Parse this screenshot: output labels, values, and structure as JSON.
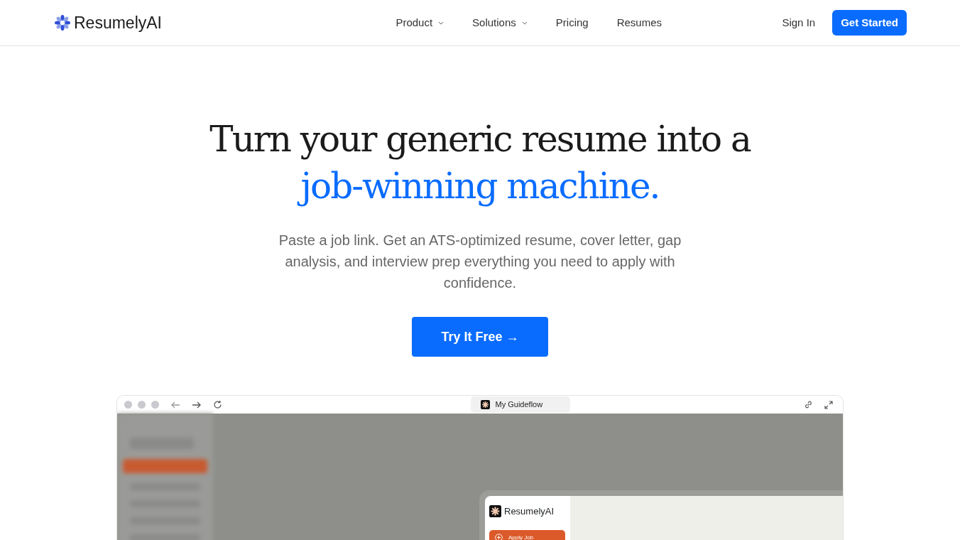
{
  "brand": {
    "name": "ResumelyAI"
  },
  "nav": [
    {
      "label": "Product",
      "dropdown": true
    },
    {
      "label": "Solutions",
      "dropdown": true
    },
    {
      "label": "Pricing",
      "dropdown": false
    },
    {
      "label": "Resumes",
      "dropdown": false
    }
  ],
  "actions": [
    {
      "label": "Sign In",
      "kind": "link"
    },
    {
      "label": "Get Started",
      "kind": "primary"
    }
  ],
  "hero": {
    "headline": [
      {
        "text": "Turn your generic resume into a",
        "accent": false
      },
      {
        "text": "job-winning machine.",
        "accent": true
      }
    ],
    "subtitle": "Paste a job link. Get an ATS-optimized resume, cover letter, gap analysis, and interview prep everything you need to apply with confidence.",
    "cta": "Try It Free →"
  },
  "demo": {
    "tab_title": "My Guideflow",
    "app_name": "ResumelyAI",
    "app_button": "Apply Job"
  }
}
